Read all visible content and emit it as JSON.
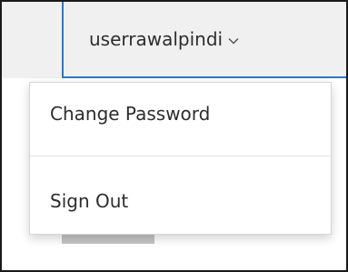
{
  "header": {
    "username": "userrawalpindi",
    "dropdown_icon": "chevron-down-icon"
  },
  "menu": {
    "items": [
      {
        "label": "Change Password"
      },
      {
        "label": "Sign Out"
      }
    ]
  },
  "colors": {
    "accent": "#2f78c4",
    "header_bg": "#f0f0f0",
    "menu_bg": "#ffffff",
    "text": "#2d2d2d",
    "divider": "#e2e2e2"
  }
}
